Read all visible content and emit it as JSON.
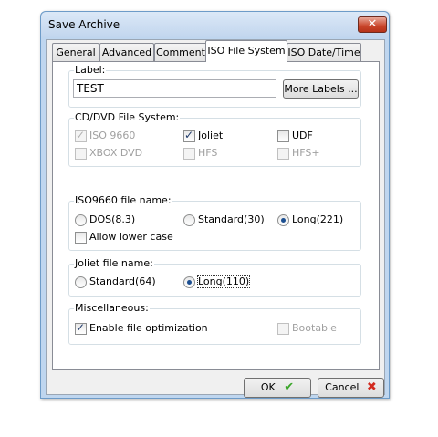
{
  "window": {
    "title": "Save Archive",
    "close_glyph": "✕"
  },
  "tabs": [
    {
      "label": "General",
      "active": false
    },
    {
      "label": "Advanced",
      "active": false
    },
    {
      "label": "Comment",
      "active": false
    },
    {
      "label": "ISO File System",
      "active": true
    },
    {
      "label": "ISO Date/Time",
      "active": false
    }
  ],
  "label_section": {
    "caption": "Label:",
    "value": "TEST",
    "more_button": "More Labels ..."
  },
  "cd_dvd": {
    "caption": "CD/DVD File System:",
    "iso9660": {
      "label": "ISO 9660",
      "checked": true,
      "disabled": true
    },
    "joliet": {
      "label": "Joliet",
      "checked": true,
      "disabled": false
    },
    "udf": {
      "label": "UDF",
      "checked": false,
      "disabled": false
    },
    "xbox": {
      "label": "XBOX DVD",
      "checked": false,
      "disabled": true
    },
    "hfs": {
      "label": "HFS",
      "checked": false,
      "disabled": true
    },
    "hfsplus": {
      "label": "HFS+",
      "checked": false,
      "disabled": true
    }
  },
  "iso_name": {
    "caption": "ISO9660 file name:",
    "dos": {
      "label": "DOS(8.3)",
      "selected": false
    },
    "standard": {
      "label": "Standard(30)",
      "selected": false
    },
    "long": {
      "label": "Long(221)",
      "selected": true
    },
    "allow_lower": {
      "label": "Allow lower case",
      "checked": false
    }
  },
  "joliet_name": {
    "caption": "Joliet file name:",
    "standard": {
      "label": "Standard(64)",
      "selected": false
    },
    "long": {
      "label": "Long(110)",
      "selected": true
    }
  },
  "misc": {
    "caption": "Miscellaneous:",
    "optimize": {
      "label": "Enable file optimization",
      "checked": true
    },
    "bootable": {
      "label": "Bootable",
      "checked": false,
      "disabled": true
    }
  },
  "buttons": {
    "ok": "OK",
    "cancel": "Cancel",
    "ok_icon": "✔",
    "cancel_icon": "✖"
  },
  "colors": {
    "ok_icon": "#3aa629",
    "cancel_icon": "#d22a1f",
    "title_bar": "#c2d6ee"
  }
}
